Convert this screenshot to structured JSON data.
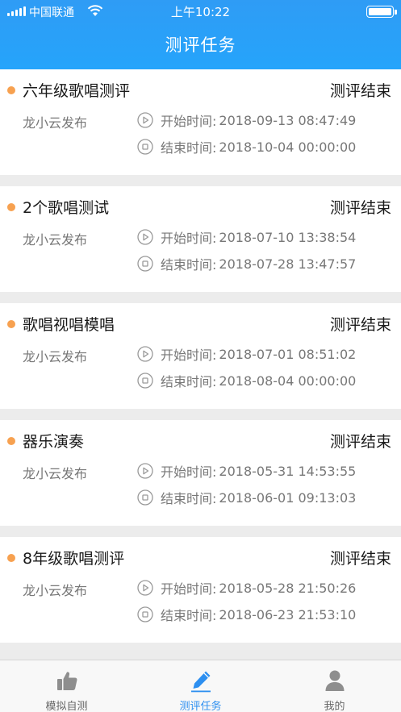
{
  "status_bar": {
    "carrier": "中国联通",
    "time": "上午10:22"
  },
  "header": {
    "title": "测评任务"
  },
  "labels": {
    "start": "开始时间:",
    "end": "结束时间:"
  },
  "tasks": [
    {
      "title": "六年级歌唱测评",
      "status": "测评结束",
      "publisher": "龙小云发布",
      "start": "2018-09-13 08:47:49",
      "end": "2018-10-04 00:00:00"
    },
    {
      "title": "2个歌唱测试",
      "status": "测评结束",
      "publisher": "龙小云发布",
      "start": "2018-07-10 13:38:54",
      "end": "2018-07-28 13:47:57"
    },
    {
      "title": "歌唱视唱模唱",
      "status": "测评结束",
      "publisher": "龙小云发布",
      "start": "2018-07-01 08:51:02",
      "end": "2018-08-04 00:00:00"
    },
    {
      "title": "器乐演奏",
      "status": "测评结束",
      "publisher": "龙小云发布",
      "start": "2018-05-31 14:53:55",
      "end": "2018-06-01 09:13:03"
    },
    {
      "title": "8年级歌唱测评",
      "status": "测评结束",
      "publisher": "龙小云发布",
      "start": "2018-05-28 21:50:26",
      "end": "2018-06-23 21:53:10"
    }
  ],
  "tabbar": {
    "items": [
      {
        "label": "模拟自测",
        "icon": "thumbs-up-icon"
      },
      {
        "label": "测评任务",
        "icon": "pencil-icon",
        "active": true
      },
      {
        "label": "我的",
        "icon": "person-icon"
      }
    ]
  },
  "colors": {
    "header": "#25a4fb",
    "accent": "#2d8ff0",
    "dot": "#f7a150"
  }
}
